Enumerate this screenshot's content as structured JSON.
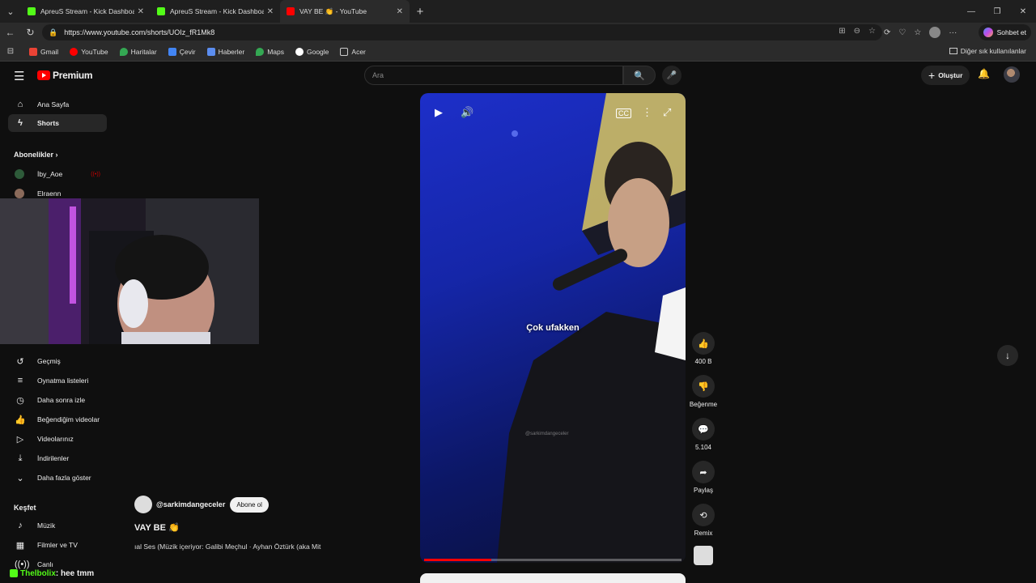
{
  "browser": {
    "tabs": [
      {
        "title": "ApreuS Stream - Kick Dashboard",
        "favicon_color": "#53fc18"
      },
      {
        "title": "ApreuS Stream - Kick Dashboard",
        "favicon_color": "#53fc18"
      },
      {
        "title": "VAY BE 👏 - YouTube",
        "favicon_color": "#ff0000"
      }
    ],
    "url": "https://www.youtube.com/shorts/UOIz_fR1Mk8",
    "chat_button": "Sohbet et",
    "bookmarks": [
      "Gmail",
      "YouTube",
      "Haritalar",
      "Çevir",
      "Haberler",
      "Maps",
      "Google",
      "Acer"
    ],
    "other_bookmarks": "Diğer sık kullanılanlar"
  },
  "youtube": {
    "logo_text": "Premium",
    "search_placeholder": "Ara",
    "create_label": "Oluştur"
  },
  "sidebar": {
    "home": "Ana Sayfa",
    "shorts": "Shorts",
    "subscriptions_header": "Abonelikler",
    "subscriptions": [
      "İby_Aoe",
      "Elraenn"
    ],
    "you_items": [
      "Geçmiş",
      "Oynatma listeleri",
      "Daha sonra izle",
      "Beğendiğim videolar",
      "Videolarınız",
      "İndirilenler",
      "Daha fazla göster"
    ],
    "explore_header": "Keşfet",
    "explore_items": [
      "Müzik",
      "Filmler ve TV",
      "Canlı"
    ]
  },
  "short": {
    "subtitle": "Çok ufakken",
    "watermark": "@sarkimdangeceler",
    "progress_percent": 26,
    "likes": "400 B",
    "dislike_label": "Beğenme",
    "comments": "5.104",
    "share_label": "Paylaş",
    "remix_label": "Remix",
    "channel": "@sarkimdangeceler",
    "subscribe_label": "Abone ol",
    "title": "VAY BE 👏",
    "music": "ıal Ses (Müzik içeriyor: Galibi Meçhul · Ayhan Öztürk (aka Mit"
  },
  "chat_overlay": {
    "user": "Thelbolix",
    "message": ": hee tmm"
  },
  "colors": {
    "kick_green": "#53fc18",
    "youtube_red": "#ff0000",
    "background": "#0f0f0f"
  }
}
